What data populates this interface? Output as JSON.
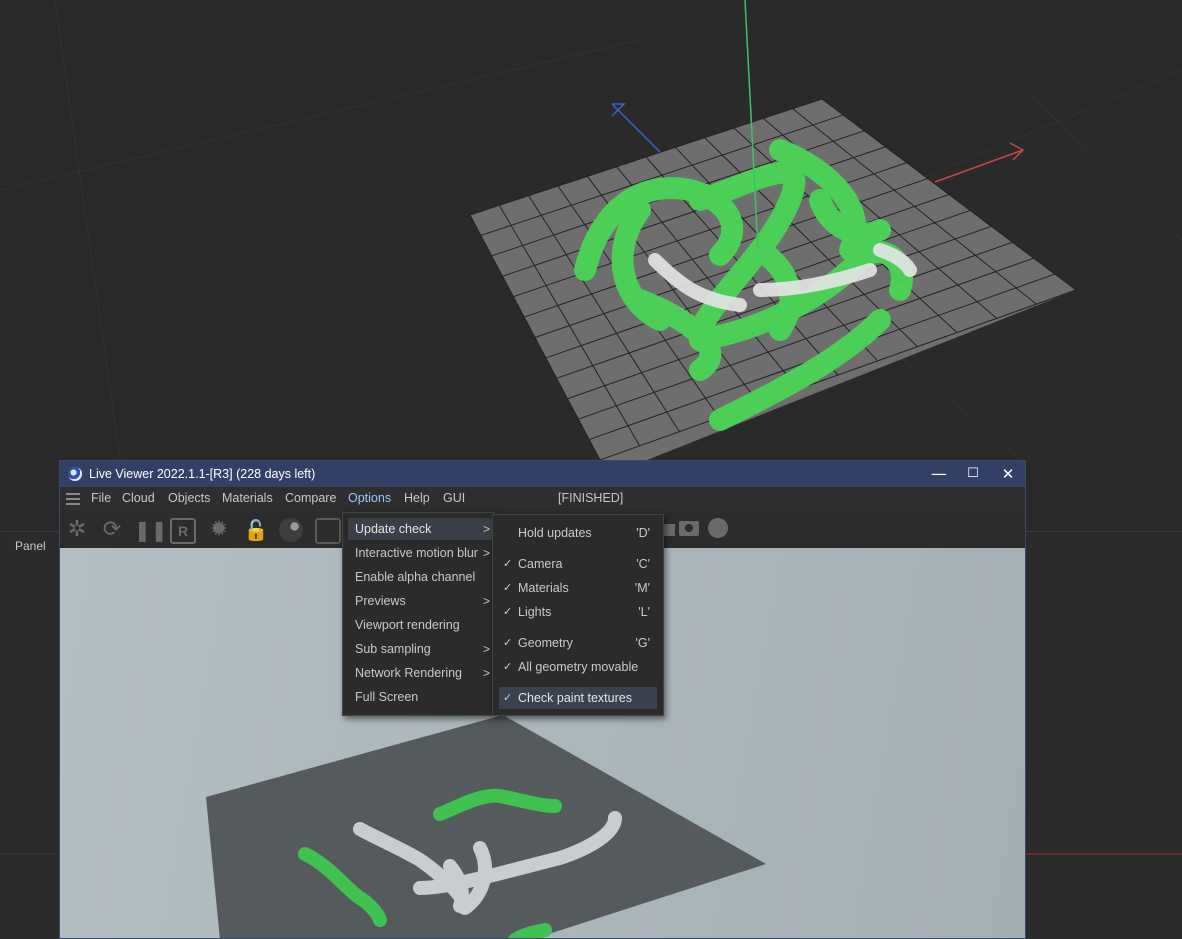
{
  "window": {
    "title": "Live Viewer 2022.1.1-[R3] (228 days left)",
    "minimize_glyph": "—",
    "maximize_glyph": "☐",
    "close_glyph": "✕"
  },
  "background": {
    "panel_label": "Panel"
  },
  "menubar": {
    "items": [
      "File",
      "Cloud",
      "Objects",
      "Materials",
      "Compare",
      "Options",
      "Help",
      "GUI"
    ],
    "active": "Options",
    "status": "[FINISHED]"
  },
  "toolbar": {
    "icons": [
      "aperture-icon",
      "refresh-icon",
      "pause-icon",
      "render-region-icon",
      "settings-gear-icon",
      "unlock-icon",
      "material-sphere-icon",
      "add-icon",
      "box-icon",
      "camera-icon",
      "circle-icon"
    ],
    "r_label": "R"
  },
  "options_menu": {
    "items": [
      {
        "label": "Update check",
        "submenu": true,
        "highlighted": true
      },
      {
        "label": "Interactive motion blur",
        "submenu": true
      },
      {
        "label": "Enable alpha channel",
        "submenu": false
      },
      {
        "label": "Previews",
        "submenu": true
      },
      {
        "label": "Viewport rendering",
        "submenu": false
      },
      {
        "label": "Sub sampling",
        "submenu": true
      },
      {
        "label": "Network Rendering",
        "submenu": true
      },
      {
        "label": "Full Screen",
        "submenu": false
      }
    ],
    "arrow": ">"
  },
  "update_submenu": {
    "items": [
      {
        "label": "Hold updates",
        "key": "'D'",
        "checked": false
      },
      {
        "label": "Camera",
        "key": "'C'",
        "checked": true
      },
      {
        "label": "Materials",
        "key": "'M'",
        "checked": true
      },
      {
        "label": "Lights",
        "key": "'L'",
        "checked": true
      },
      {
        "label": "Geometry",
        "key": "'G'",
        "checked": true
      },
      {
        "label": "All geometry movable",
        "key": "",
        "checked": true
      },
      {
        "label": "Check paint textures",
        "key": "",
        "checked": true,
        "highlighted": true
      }
    ],
    "check_glyph": "✓"
  },
  "colors": {
    "titlebar": "#334065",
    "paint_green": "#4cd85a",
    "plane_gray": "#6b6b6b",
    "render_bg": "#aab5ba"
  }
}
